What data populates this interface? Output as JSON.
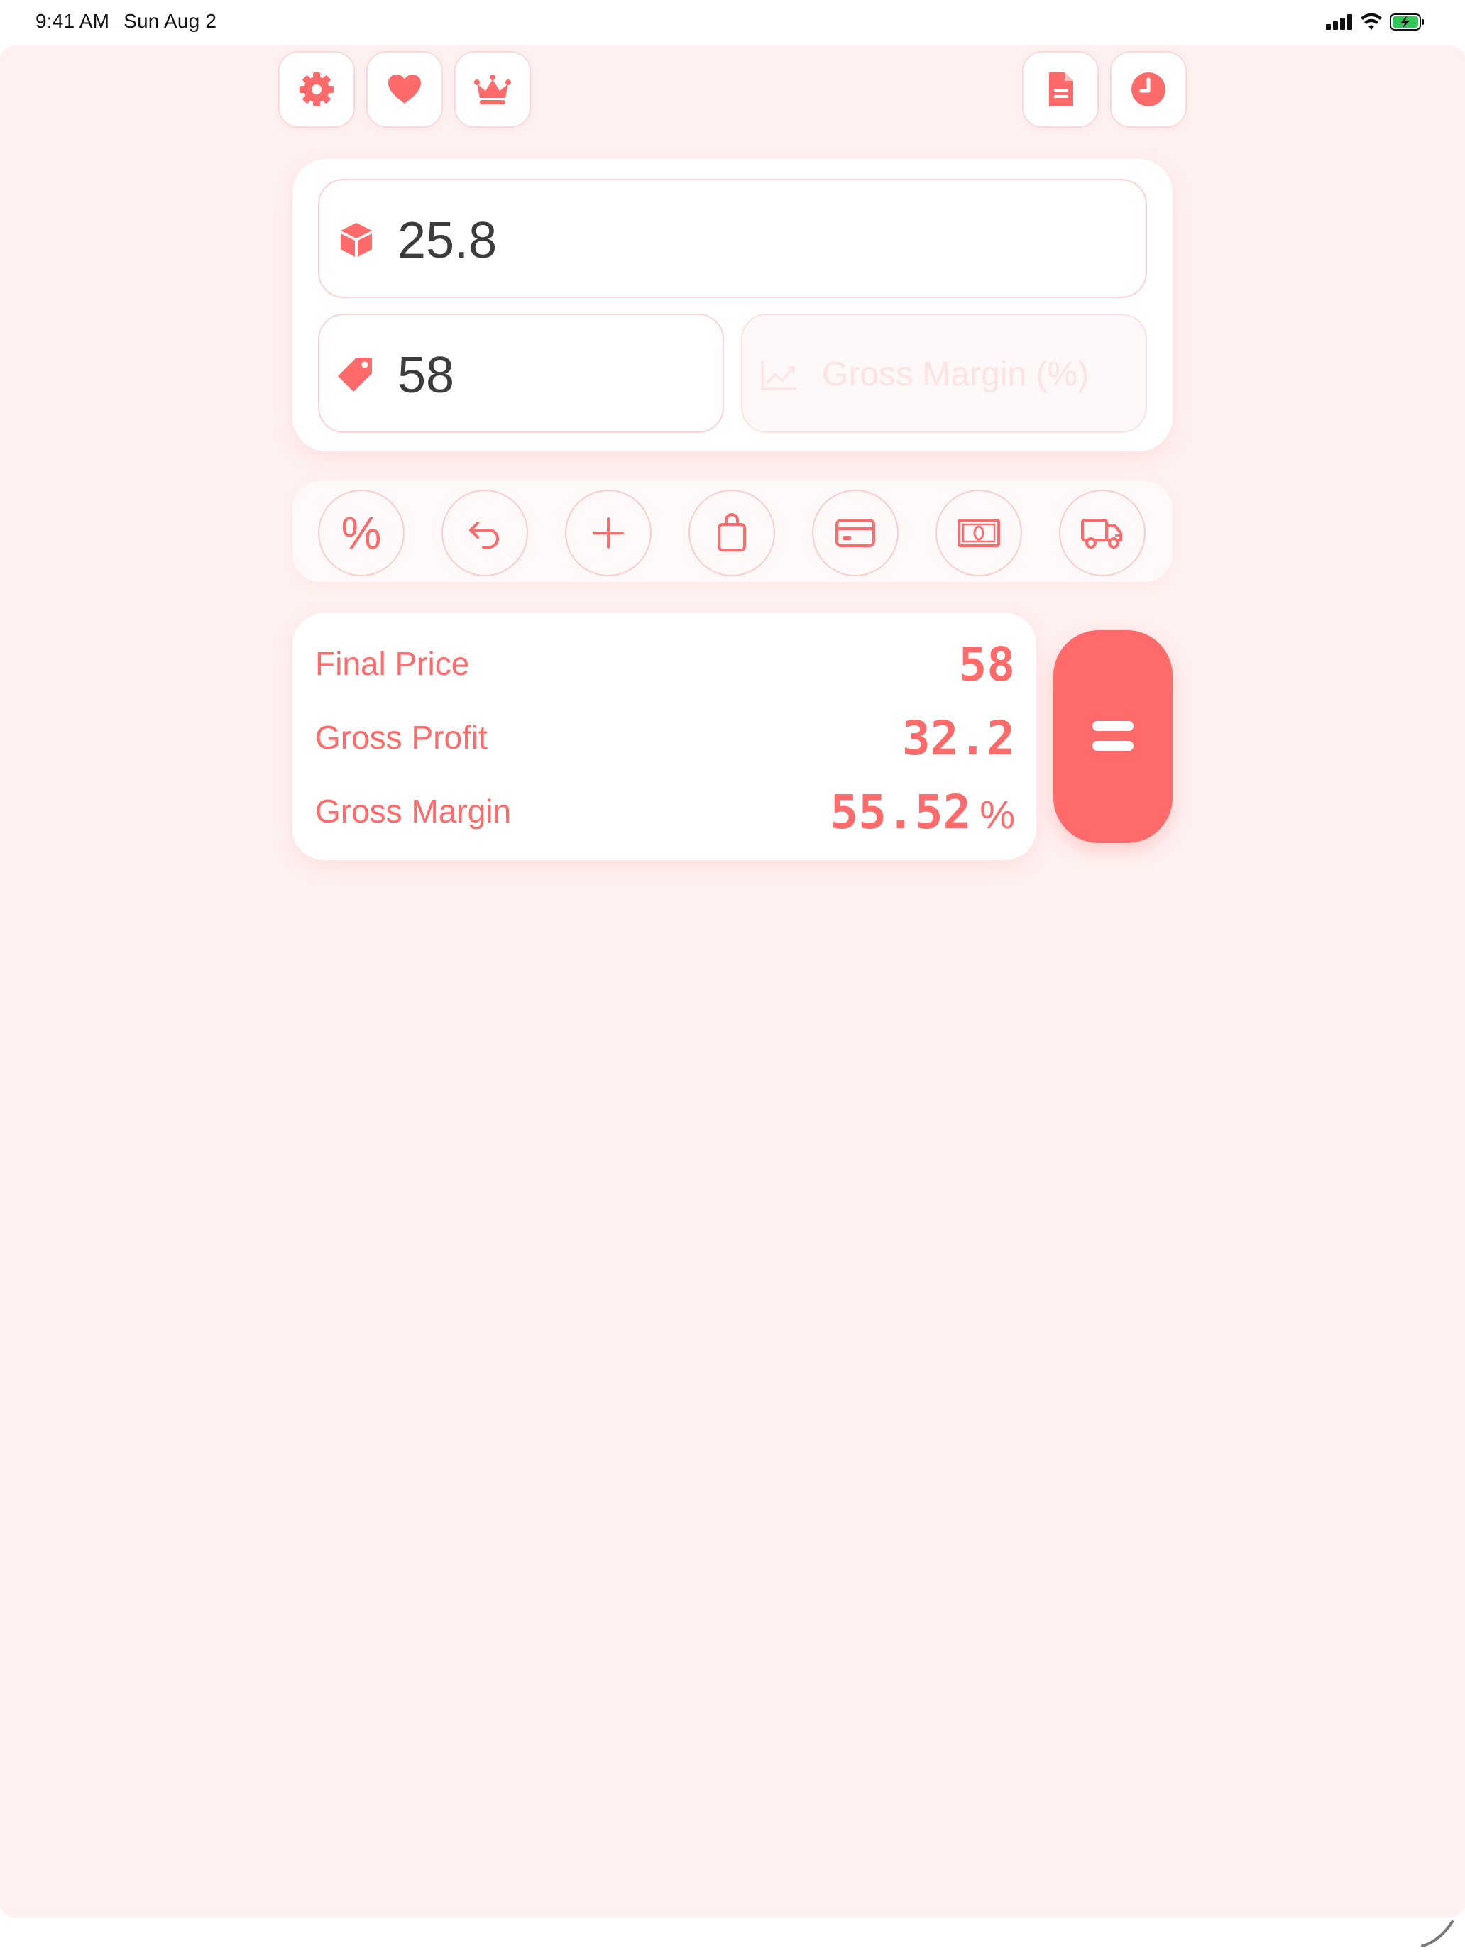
{
  "status_bar": {
    "time": "9:41 AM",
    "date": "Sun Aug 2"
  },
  "toolbar": {
    "left_icons": [
      "gear-icon",
      "heart-icon",
      "crown-icon"
    ],
    "right_icons": [
      "document-icon",
      "clock-icon"
    ]
  },
  "inputs": {
    "cost": {
      "icon": "box-icon",
      "value": "25.8"
    },
    "price": {
      "icon": "tag-icon",
      "value": "58"
    },
    "gross_margin": {
      "icon": "chart-line-icon",
      "placeholder": "Gross Margin (%)"
    }
  },
  "tools": [
    {
      "name": "percent",
      "label": "%"
    },
    {
      "name": "undo"
    },
    {
      "name": "add"
    },
    {
      "name": "shopping-bag"
    },
    {
      "name": "credit-card"
    },
    {
      "name": "cash"
    },
    {
      "name": "delivery-truck"
    }
  ],
  "results": {
    "final_price": {
      "label": "Final Price",
      "value": "58"
    },
    "gross_profit": {
      "label": "Gross Profit",
      "value": "32.2"
    },
    "gross_margin": {
      "label": "Gross Margin",
      "value": "55.52",
      "unit": "%"
    }
  },
  "colors": {
    "accent": "#ff6b6b",
    "background": "#fff1f1",
    "card": "#ffffff",
    "border": "#fbd3d3",
    "input_text": "#3c3c3c"
  }
}
